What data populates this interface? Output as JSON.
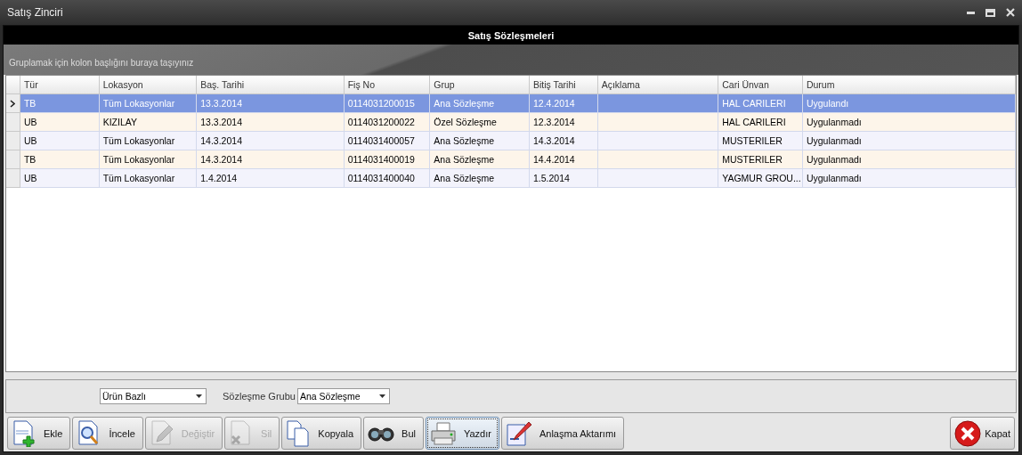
{
  "window": {
    "title": "Satış Zinciri"
  },
  "header": {
    "title": "Satış Sözleşmeleri"
  },
  "group_panel": {
    "hint": "Gruplamak için kolon başlığını buraya taşıyınız"
  },
  "table": {
    "columns": [
      "Tür",
      "Lokasyon",
      "Baş. Tarihi",
      "Fiş No",
      "Grup",
      "Bitiş Tarihi",
      "Açıklama",
      "Cari Ünvan",
      "Durum"
    ],
    "rows": [
      {
        "selected": true,
        "cells": [
          "TB",
          "Tüm Lokasyonlar",
          "13.3.2014",
          "0114031200015",
          "Ana Sözleşme",
          "12.4.2014",
          "",
          "HAL CARILERI",
          "Uygulandı"
        ]
      },
      {
        "selected": false,
        "cells": [
          "UB",
          "KIZILAY",
          "13.3.2014",
          "0114031200022",
          "Özel Sözleşme",
          "12.3.2014",
          "",
          "HAL CARILERI",
          "Uygulanmadı"
        ]
      },
      {
        "selected": false,
        "cells": [
          "UB",
          "Tüm Lokasyonlar",
          "14.3.2014",
          "0114031400057",
          "Ana Sözleşme",
          "14.3.2014",
          "",
          "MUSTERILER",
          "Uygulanmadı"
        ]
      },
      {
        "selected": false,
        "cells": [
          "TB",
          "Tüm Lokasyonlar",
          "14.3.2014",
          "0114031400019",
          "Ana Sözleşme",
          "14.4.2014",
          "",
          "MUSTERILER",
          "Uygulanmadı"
        ]
      },
      {
        "selected": false,
        "cells": [
          "UB",
          "Tüm Lokasyonlar",
          "1.4.2014",
          "0114031400040",
          "Ana Sözleşme",
          "1.5.2014",
          "",
          "YAGMUR GROU...",
          "Uygulanmadı"
        ]
      }
    ]
  },
  "filters": [
    {
      "value": "Ürün Bazlı"
    },
    {
      "label": "Sözleşme Grubu",
      "value": "Ana Sözleşme"
    }
  ],
  "buttons": [
    {
      "label": "Ekle",
      "disabled": false,
      "focused": false
    },
    {
      "label": "İncele",
      "disabled": false,
      "focused": false
    },
    {
      "label": "Değiştir",
      "disabled": true,
      "focused": false
    },
    {
      "label": "Sil",
      "disabled": true,
      "focused": false
    },
    {
      "label": "Kopyala",
      "disabled": false,
      "focused": false
    },
    {
      "label": "Bul",
      "disabled": false,
      "focused": false
    },
    {
      "label": "Yazdır",
      "disabled": false,
      "focused": true
    },
    {
      "label": "Anlaşma Aktarımı",
      "disabled": false,
      "focused": false
    }
  ],
  "close_button": {
    "label": "Kapat"
  }
}
